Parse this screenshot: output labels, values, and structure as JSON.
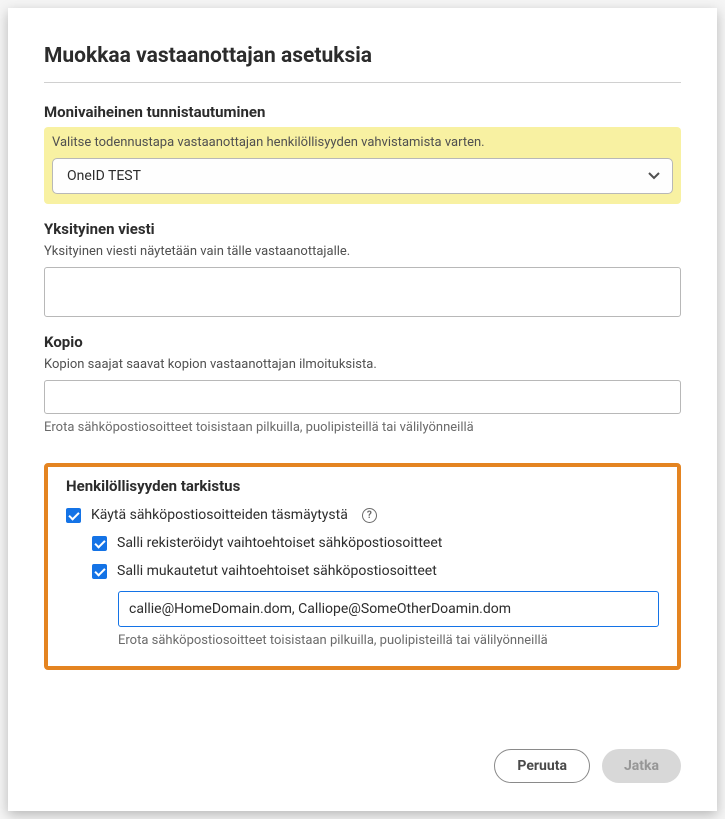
{
  "dialog": {
    "title": "Muokkaa vastaanottajan asetuksia"
  },
  "mfa": {
    "label": "Monivaiheinen tunnistautuminen",
    "desc": "Valitse todennustapa vastaanottajan henkilöllisyyden vahvistamista varten.",
    "selected": "OneID TEST"
  },
  "privateMsg": {
    "label": "Yksityinen viesti",
    "desc": "Yksityinen viesti näytetään vain tälle vastaanottajalle.",
    "value": ""
  },
  "copy": {
    "label": "Kopio",
    "desc": "Kopion saajat saavat kopion vastaanottajan ilmoituksista.",
    "value": "",
    "hint": "Erota sähköpostiosoitteet toisistaan pilkuilla, puolipisteillä tai välilyönneillä"
  },
  "identity": {
    "label": "Henkilöllisyyden tarkistus",
    "useMatch": "Käytä sähköpostiosoitteiden täsmäytystä",
    "allowRegistered": "Salli rekisteröidyt vaihtoehtoiset sähköpostiosoitteet",
    "allowCustom": "Salli mukautetut vaihtoehtoiset sähköpostiosoitteet",
    "customValue": "callie@HomeDomain.dom, Calliope@SomeOtherDoamin.dom",
    "hint": "Erota sähköpostiosoitteet toisistaan pilkuilla, puolipisteillä tai välilyönneillä"
  },
  "buttons": {
    "cancel": "Peruuta",
    "continue": "Jatka"
  }
}
